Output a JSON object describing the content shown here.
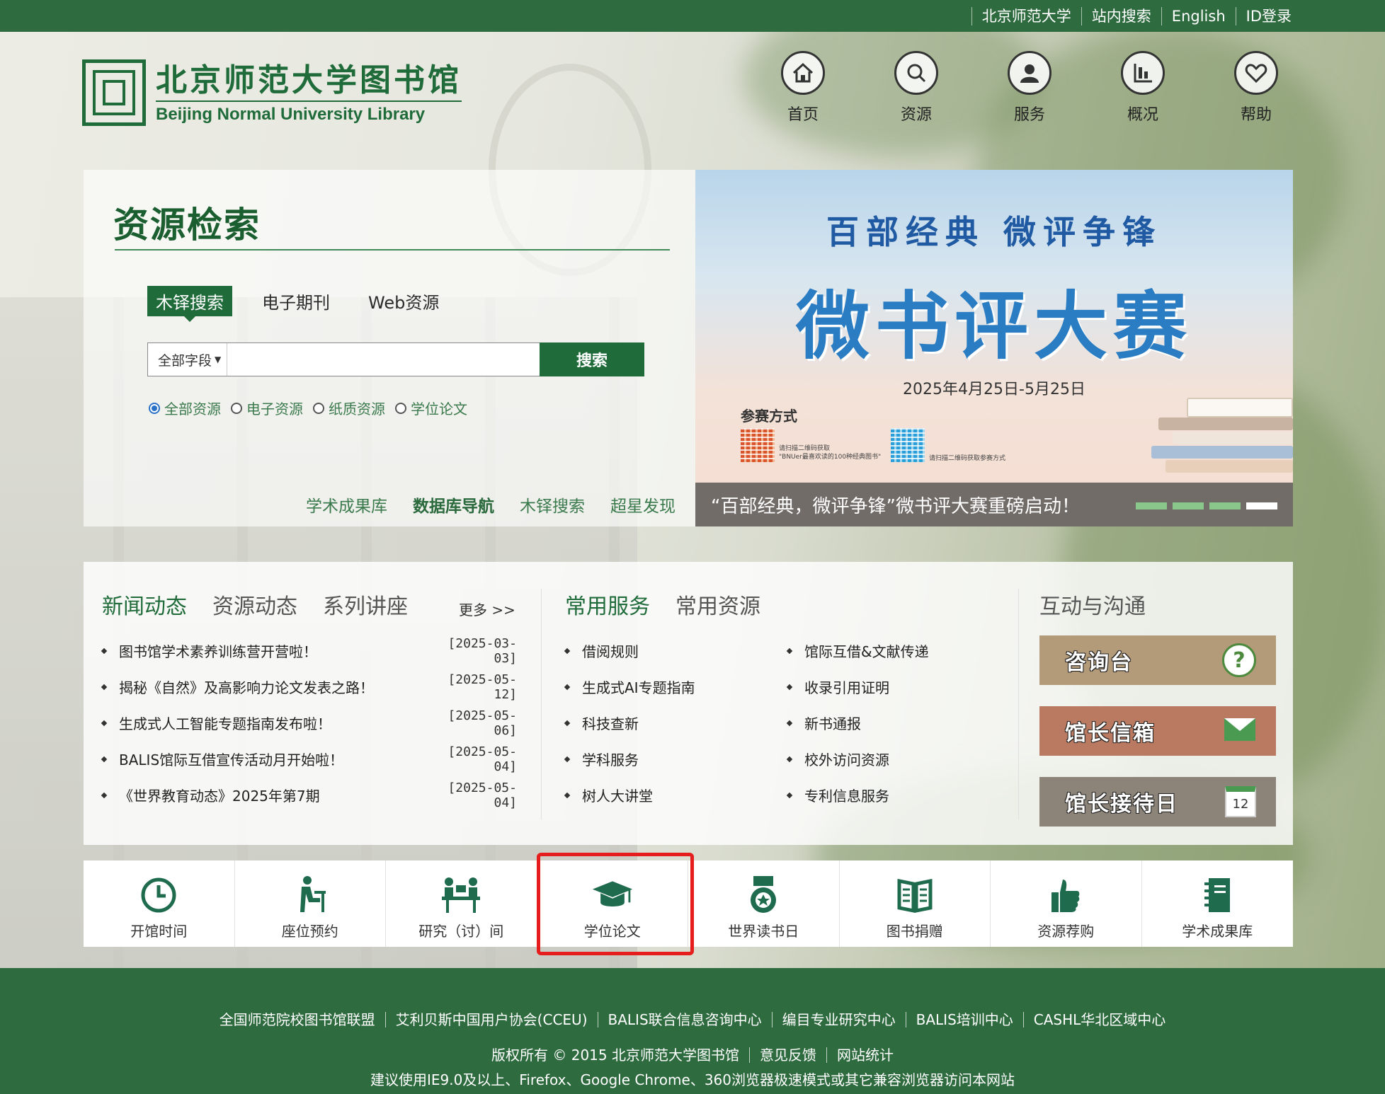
{
  "topbar": {
    "links": [
      "北京师范大学",
      "站内搜索",
      "English",
      "ID登录"
    ]
  },
  "logo": {
    "cn": "北京师范大学图书馆",
    "en": "Beijing Normal University Library"
  },
  "nav": [
    {
      "label": "首页",
      "icon": "home-icon"
    },
    {
      "label": "资源",
      "icon": "search-icon"
    },
    {
      "label": "服务",
      "icon": "user-icon"
    },
    {
      "label": "概况",
      "icon": "chart-icon"
    },
    {
      "label": "帮助",
      "icon": "heart-icon"
    }
  ],
  "search": {
    "title": "资源检索",
    "tabs": [
      "木铎搜索",
      "电子期刊",
      "Web资源"
    ],
    "active_tab": 0,
    "field": "全部字段",
    "input_value": "",
    "button": "搜索",
    "radios": [
      "全部资源",
      "电子资源",
      "纸质资源",
      "学位论文"
    ],
    "radio_selected": 0,
    "quick_links": [
      "学术成果库",
      "数据库导航",
      "木铎搜索",
      "超星发现"
    ]
  },
  "banner": {
    "subtitle": "百部经典  微评争锋",
    "title": "微书评大赛",
    "date": "2025年4月25日-5月25日",
    "how": "参赛方式",
    "qr1_note": "请扫描二维码获取\n\"BNUer最喜欢读的100种经典图书\"",
    "qr2_note": "请扫描二维码获取参赛方式",
    "caption": "“百部经典，微评争锋”微书评大赛重磅启动！",
    "slides": 4,
    "active_slide": 3
  },
  "news": {
    "tabs": [
      "新闻动态",
      "资源动态",
      "系列讲座"
    ],
    "more": "更多 >>",
    "items": [
      {
        "title": "图书馆学术素养训练营开营啦！",
        "date": "[2025-03-03]"
      },
      {
        "title": "揭秘《自然》及高影响力论文发表之路！",
        "date": "[2025-05-12]"
      },
      {
        "title": "生成式人工智能专题指南发布啦！",
        "date": "[2025-05-06]"
      },
      {
        "title": "BALIS馆际互借宣传活动月开始啦！",
        "date": "[2025-05-04]"
      },
      {
        "title": "《世界教育动态》2025年第7期",
        "date": "[2025-05-04]"
      }
    ]
  },
  "services": {
    "tabs": [
      "常用服务",
      "常用资源"
    ],
    "col1": [
      "借阅规则",
      "生成式AI专题指南",
      "科技查新",
      "学科服务",
      "树人大讲堂"
    ],
    "col2": [
      "馆际互借&文献传递",
      "收录引用证明",
      "新书通报",
      "校外访问资源",
      "专利信息服务"
    ]
  },
  "interact": {
    "title": "互动与沟通",
    "buttons": [
      {
        "label": "咨询台",
        "icon": "question-icon",
        "color": "#b39a78"
      },
      {
        "label": "馆长信箱",
        "icon": "mail-icon",
        "color": "#b97a61"
      },
      {
        "label": "馆长接待日",
        "icon": "calendar-icon",
        "color": "#8c8478",
        "cal_num": "12"
      }
    ]
  },
  "quickbar": [
    {
      "label": "开馆时间",
      "icon": "clock-icon"
    },
    {
      "label": "座位预约",
      "icon": "seat-icon"
    },
    {
      "label": "研究（讨）间",
      "icon": "discussion-icon"
    },
    {
      "label": "学位论文",
      "icon": "graduation-cap-icon"
    },
    {
      "label": "世界读书日",
      "icon": "medal-icon"
    },
    {
      "label": "图书捐赠",
      "icon": "book-icon"
    },
    {
      "label": "资源荐购",
      "icon": "thumbs-up-icon"
    },
    {
      "label": "学术成果库",
      "icon": "notebook-icon"
    }
  ],
  "footer": {
    "links": [
      "全国师范院校图书馆联盟",
      "艾利贝斯中国用户协会(CCEU)",
      "BALIS联合信息咨询中心",
      "编目专业研究中心",
      "BALIS培训中心",
      "CASHL华北区域中心"
    ],
    "copyright": "版权所有 © 2015 北京师范大学图书馆",
    "feedback": "意见反馈",
    "stats": "网站统计",
    "note": "建议使用IE9.0及以上、Firefox、Google Chrome、360浏览器极速模式或其它兼容浏览器访问本网站"
  },
  "colors": {
    "brand_green": "#2e6b3f",
    "dark_green": "#1f6b3a",
    "highlight_red": "#e51d1d"
  }
}
